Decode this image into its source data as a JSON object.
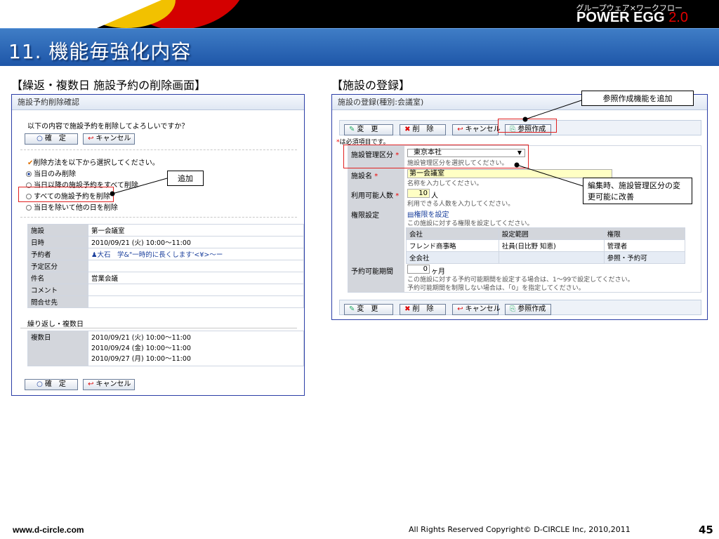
{
  "header": {
    "brand_sub": "グループウェア×ワークフロー",
    "brand_main": "POWER EGG",
    "brand_version": "2.0",
    "slide_title": "11. 機能毎強化内容"
  },
  "left": {
    "section_title": "【繰返・複数日 施設予約の削除画面】",
    "panel_title": "施設予約削除確認",
    "confirm_text": "以下の内容で施設予約を削除してよろしいですか？",
    "confirm_btn": "確　定",
    "cancel_btn": "キャンセル",
    "method_title": "削除方法を以下から選択してください。",
    "options": [
      "当日のみ削除",
      "当日以降の施設予約をすべて削除",
      "すべての施設予約を削除",
      "当日を除いて他の日を削除"
    ],
    "rows": [
      {
        "label": "施設",
        "value": "第一会議室"
      },
      {
        "label": "日時",
        "value": "2010/09/21 (火) 10:00〜11:00"
      },
      {
        "label": "予約者",
        "value": "大石　学&\"一時的に長くします'<¥>〜ー"
      },
      {
        "label": "予定区分",
        "value": ""
      },
      {
        "label": "件名",
        "value": "営業会議"
      },
      {
        "label": "コメント",
        "value": ""
      },
      {
        "label": "問合せ先",
        "value": ""
      }
    ],
    "repeat_title": "繰り返し・複数日",
    "multi_label": "複数日",
    "multi_dates": [
      "2010/09/21 (火) 10:00〜11:00",
      "2010/09/24 (金) 10:00〜11:00",
      "2010/09/27 (月) 10:00〜11:00"
    ],
    "callout": "追加"
  },
  "right": {
    "section_title": "【施設の登録】",
    "panel_title": "施設の登録(種別:会議室)",
    "btn_change": "変　更",
    "btn_delete": "削　除",
    "btn_cancel": "キャンセル",
    "btn_ref": "参照作成",
    "required_note": "は必須項目です。",
    "facility_cat_label": "施設管理区分",
    "facility_cat_value": "東京本社",
    "facility_cat_hint": "施設管理区分を選択してください。",
    "facility_name_label": "施設名",
    "facility_name_value": "第一会議室",
    "facility_name_hint": "名称を入力してください。",
    "capacity_label": "利用可能人数",
    "capacity_value": "10",
    "capacity_unit": "人",
    "capacity_hint": "利用できる人数を入力してください。",
    "perm_label": "権限設定",
    "perm_link": "権限を設定",
    "perm_hint": "この施設に対する権限を設定してください。",
    "perm_headers": [
      "会社",
      "設定範囲",
      "権限"
    ],
    "perm_rows": [
      [
        "フレンド商事略",
        "社員(日比野 知恵)",
        "管理者"
      ],
      [
        "全会社",
        "",
        "参照・予約可"
      ]
    ],
    "period_label": "予約可能期間",
    "period_value": "0",
    "period_unit": "ヶ月",
    "period_hint1": "この施設に対する予約可能期間を設定する場合は、1〜99で設定してください。",
    "period_hint2": "予約可能期間を制限しない場合は、「0」を指定してください。",
    "callout_ref": "参照作成機能を追加",
    "callout_edit": "編集時、施設管理区分の変更可能に改善"
  },
  "footer": {
    "url": "www.d-circle.com",
    "copyright": "All Rights Reserved Copyright© D-CIRCLE Inc, 2010,2011",
    "page": "45"
  }
}
